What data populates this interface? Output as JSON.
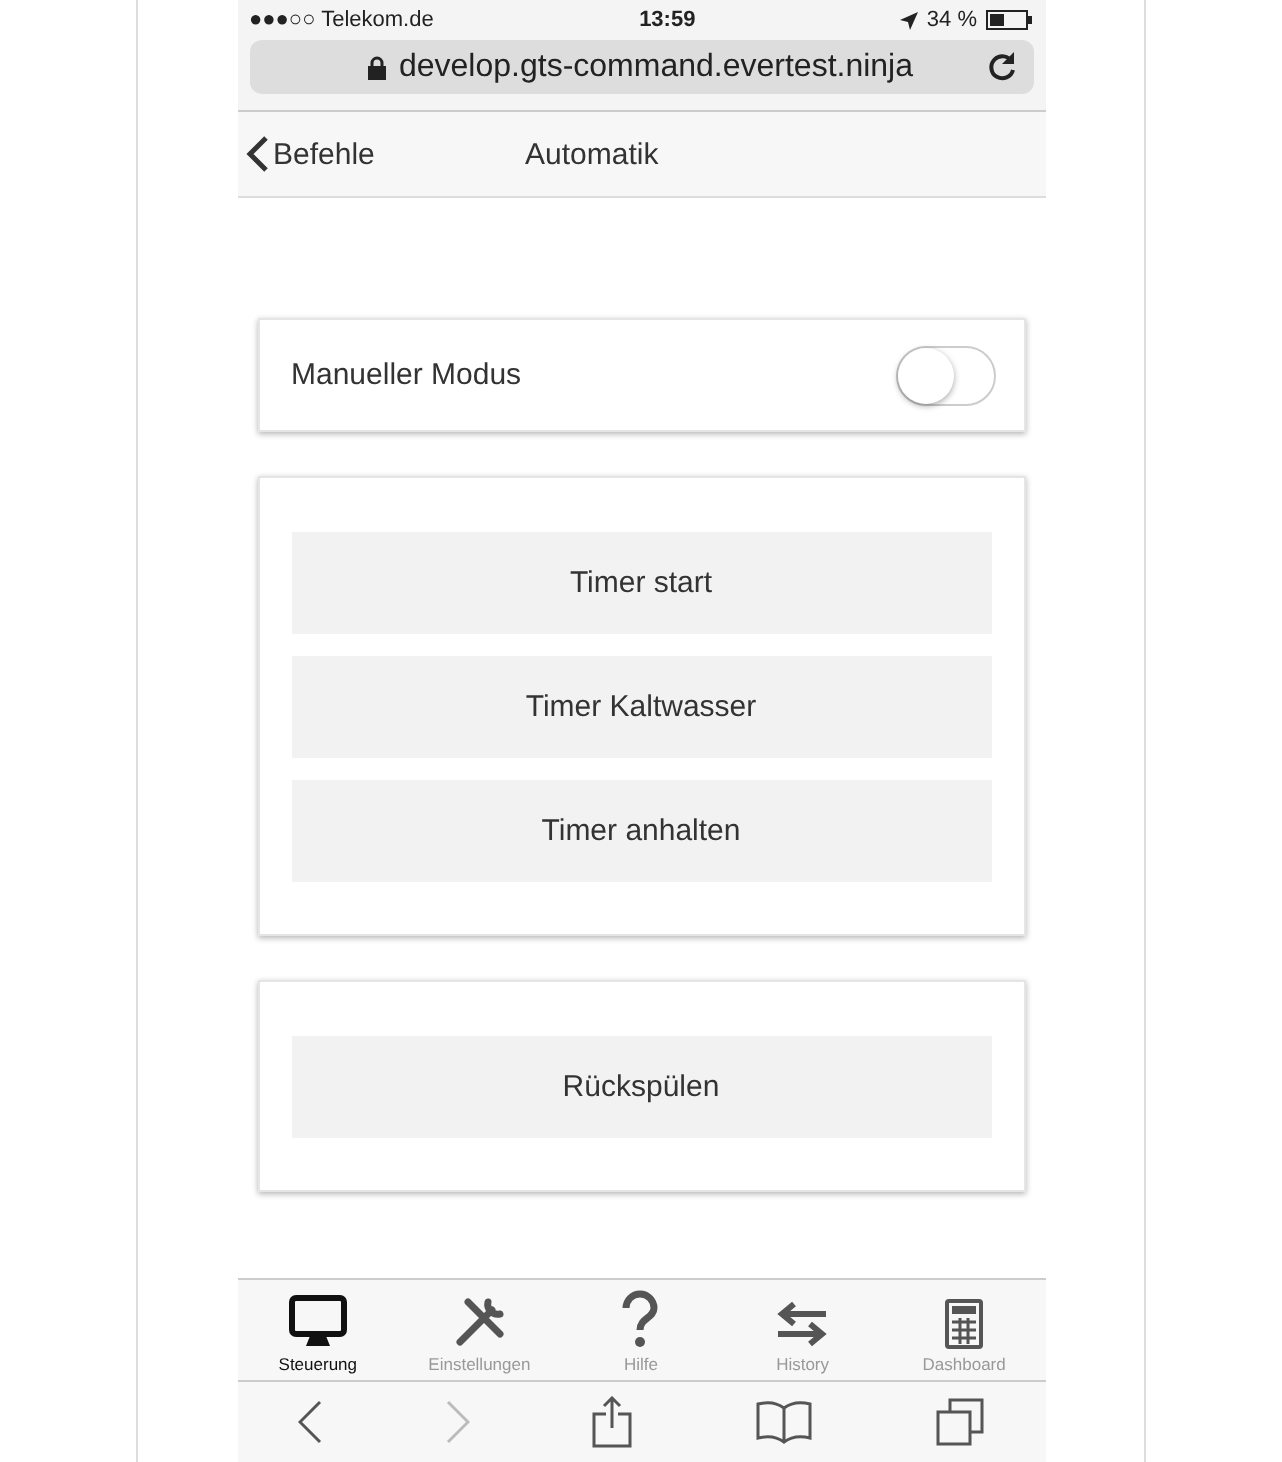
{
  "status_bar": {
    "carrier": "●●●○○ Telekom.de",
    "time": "13:59",
    "battery": "34 %"
  },
  "address_bar": {
    "url": "develop.gts-command.evertest.ninja"
  },
  "nav_bar": {
    "back": "Befehle",
    "title": "Automatik"
  },
  "cards": [
    {
      "kind": "toggle",
      "label": "Manueller Modus",
      "on": false
    },
    {
      "kind": "buttons",
      "buttons": [
        "Timer start",
        "Timer Kaltwasser",
        "Timer anhalten"
      ]
    },
    {
      "kind": "buttons",
      "buttons": [
        "Rückspülen"
      ]
    }
  ],
  "tabs": [
    {
      "label": "Steuerung",
      "kind": "monitor",
      "selected": true
    },
    {
      "label": "Einstellungen",
      "kind": "tools",
      "selected": false
    },
    {
      "label": "Hilfe",
      "kind": "help",
      "selected": false
    },
    {
      "label": "History",
      "kind": "arrows",
      "selected": false
    },
    {
      "label": "Dashboard",
      "kind": "calculator",
      "selected": false
    }
  ]
}
